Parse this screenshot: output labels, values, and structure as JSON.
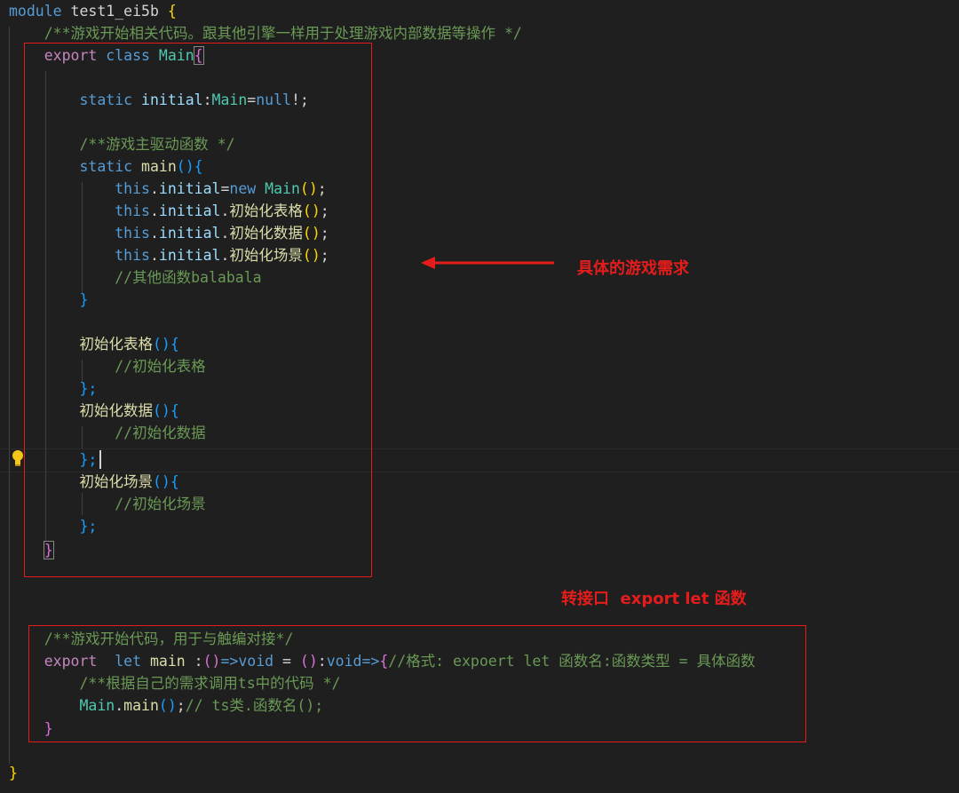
{
  "editor": {
    "module_kw": "module",
    "module_name": "test1_ei5b",
    "brace_open": "{",
    "brace_close": "}",
    "l2_comment": "/**游戏开始相关代码。跟其他引擎一样用于处理游戏内部数据等操作 */",
    "export_kw": "export",
    "class_kw": "class",
    "class_name": "Main",
    "static_kw": "static",
    "initial_name": "initial",
    "colon": ":",
    "type_main": "Main",
    "eq": "=",
    "null_kw": "null",
    "bang_semi": "!;",
    "main_comment": "/**游戏主驱动函数 */",
    "main_fn": "main",
    "paren_open": "(",
    "paren_close": ")",
    "this_kw": "this",
    "dot": ".",
    "new_kw": "new",
    "semi": ";",
    "fn_biaoge": "初始化表格",
    "fn_shuju": "初始化数据",
    "fn_changjing": "初始化场景",
    "other_comment": "//其他函数balabala",
    "cm_biaoge": "//初始化表格",
    "cm_shuju": "//初始化数据",
    "cm_changjing": "//初始化场景",
    "brace_semi_close": "};",
    "start_comment": "/**游戏开始代码，用于与触编对接*/",
    "let_kw": "let",
    "arrow_op": "=>",
    "void_kw": "void",
    "format_comment": "//格式: expoert let 函数名:函数类型 = 具体函数",
    "ts_comment": "/**根据自己的需求调用ts中的代码 */",
    "ts_call_comment": "// ts类.函数名();"
  },
  "annotations": {
    "game_req": "具体的游戏需求",
    "interface": "转接口  export let 函数"
  },
  "colors": {
    "background": "#1f1f1f",
    "annotation_red": "#e51c1c",
    "keyword": "#569cd6",
    "type": "#4ec9b0",
    "function": "#dcdcaa",
    "comment": "#6a9955"
  }
}
